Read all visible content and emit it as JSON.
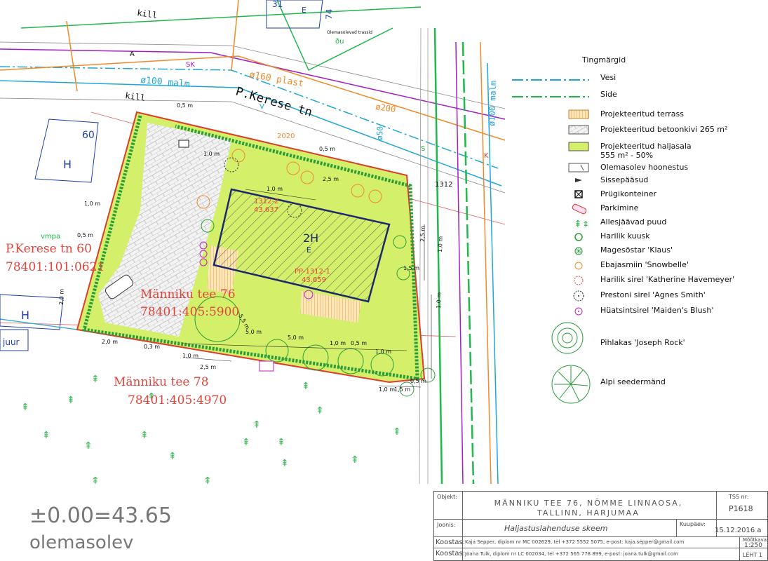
{
  "streets": {
    "p_kerese": "P.Kerese tn",
    "kill_1": "kill",
    "kill_2": "kill"
  },
  "pipes": {
    "malm_100_top": "ø100 malm",
    "plast_160": "ø160 plast",
    "d200": "ø200",
    "d50": "ø50",
    "malm_100_right": "ø100 malm",
    "sk": "SK",
    "v": "V",
    "a": "A",
    "k": "K",
    "s": "S",
    "du": "ðu",
    "year": "2020",
    "olemasolevad": "Olemasolevad trassid",
    "vmpa": "vmpa",
    "num_1312": "1312"
  },
  "parcels": {
    "kerese60_a": "P.Kerese tn 60",
    "kerese60_b": "78401:101:0621",
    "manniku76_a": "Männiku tee 76",
    "manniku76_b": "78401:405:5900",
    "manniku78_a": "Männiku tee 78",
    "manniku78_b": "78401:405:4970",
    "house60_num": "60",
    "house60_letter": "H",
    "house31": "31",
    "house74": "74",
    "house_e_top": "E",
    "h_left": "H",
    "juur": "juur",
    "pp_1312_1": "PP-1312-1",
    "pp_1312_1_h": "43.659",
    "n1312_2": "1312-2",
    "n1312_2_h": "43.637",
    "building_2h": "2H",
    "building_e": "E"
  },
  "dimensions": [
    "1,0 m",
    "0,5 m",
    "2,0 m",
    "1,0 m",
    "0,5 m",
    "2,5 m",
    "1,0 m",
    "5,0 m",
    "5,0 m",
    "1,0 m",
    "0,5 m",
    "0,3 m",
    "2,0 m",
    "2,5 m",
    "1,0 m",
    "1,5 m",
    "0,5 m",
    "0,5 m",
    "2,5 m",
    "1,0 m",
    "1,5 m",
    "1,0 m",
    "5,5 m",
    "1,0 m",
    "1,0 m"
  ],
  "legend": {
    "title": "Tingmärgid",
    "items": [
      {
        "label": "Vesi",
        "sym": "water-line"
      },
      {
        "label": "Side",
        "sym": "comm-line"
      },
      {
        "label": "Projekteeritud terrass",
        "sym": "terrace"
      },
      {
        "label": "Projekteeritud betoonkivi 265 m²",
        "sym": "paving"
      },
      {
        "label": "Projekteeritud haljasala",
        "label2": "555 m² - 50%",
        "sym": "green"
      },
      {
        "label": "Olemasolev hoonestus",
        "sym": "building"
      },
      {
        "label": "Sissepääsud",
        "sym": "entrance"
      },
      {
        "label": "Prügikonteiner",
        "sym": "bin"
      },
      {
        "label": "Parkimine",
        "sym": "car"
      },
      {
        "label": "Allesjäävad puud",
        "sym": "trees"
      },
      {
        "label": "Harilik kuusk",
        "sym": "spruce"
      },
      {
        "label": "Magesõstar 'Klaus'",
        "sym": "currant"
      },
      {
        "label": "Ebajasmiin 'Snowbelle'",
        "sym": "jasmine"
      },
      {
        "label": "Harilik sirel 'Katherine Havemeyer'",
        "sym": "lilac"
      },
      {
        "label": "Prestoni sirel 'Agnes Smith'",
        "sym": "preston"
      },
      {
        "label": "Hüatsintsirel 'Maiden's Blush'",
        "sym": "hyacinth"
      },
      {
        "label": "Pihlakas 'Joseph Rock'",
        "sym": "rowan"
      },
      {
        "label": "Alpi seedermänd",
        "sym": "pine"
      }
    ]
  },
  "elevation": {
    "value": "±0.00=43.65",
    "note": "olemasolev"
  },
  "title_block": {
    "objekt_lbl": "Objekt:",
    "objekt_1": "MÄNNIKU TEE 76, NÕMME LINNAOSA,",
    "objekt_2": "TALLINN, HARJUMAA",
    "tss_lbl": "TSS nr:",
    "tss": "P1618",
    "joonis_lbl": "Joonis:",
    "joonis": "Haljastuslahenduse skeem",
    "kuup_lbl": "Kuupäev:",
    "kuup": "15.12.2016 a",
    "koostas_lbl": "Koostas:",
    "koostas_1": "Kaja Sepper, diplom nr MC 002629, tel +372 5552 5075, e-post: kaja.sepper@gmail.com",
    "koostas_2": "Joana Tulk, diplom nr LC 002034, tel +372 565 778 899, e-post: joana.tulk@gmail.com",
    "mootkava_lbl": "Mõõtkava:",
    "mootkava": "1:250",
    "leht": "LEHT 1"
  },
  "colors": {
    "green_area": "#d4f06a",
    "hedge": "#2a9d3a",
    "boundary": "#e03a2a",
    "water": "#1fa6d6",
    "comm": "#1fb84a",
    "sewer": "#a020c0",
    "gas": "#f08a28",
    "terrace": "#e8b04a",
    "redtext": "#e0453c"
  }
}
